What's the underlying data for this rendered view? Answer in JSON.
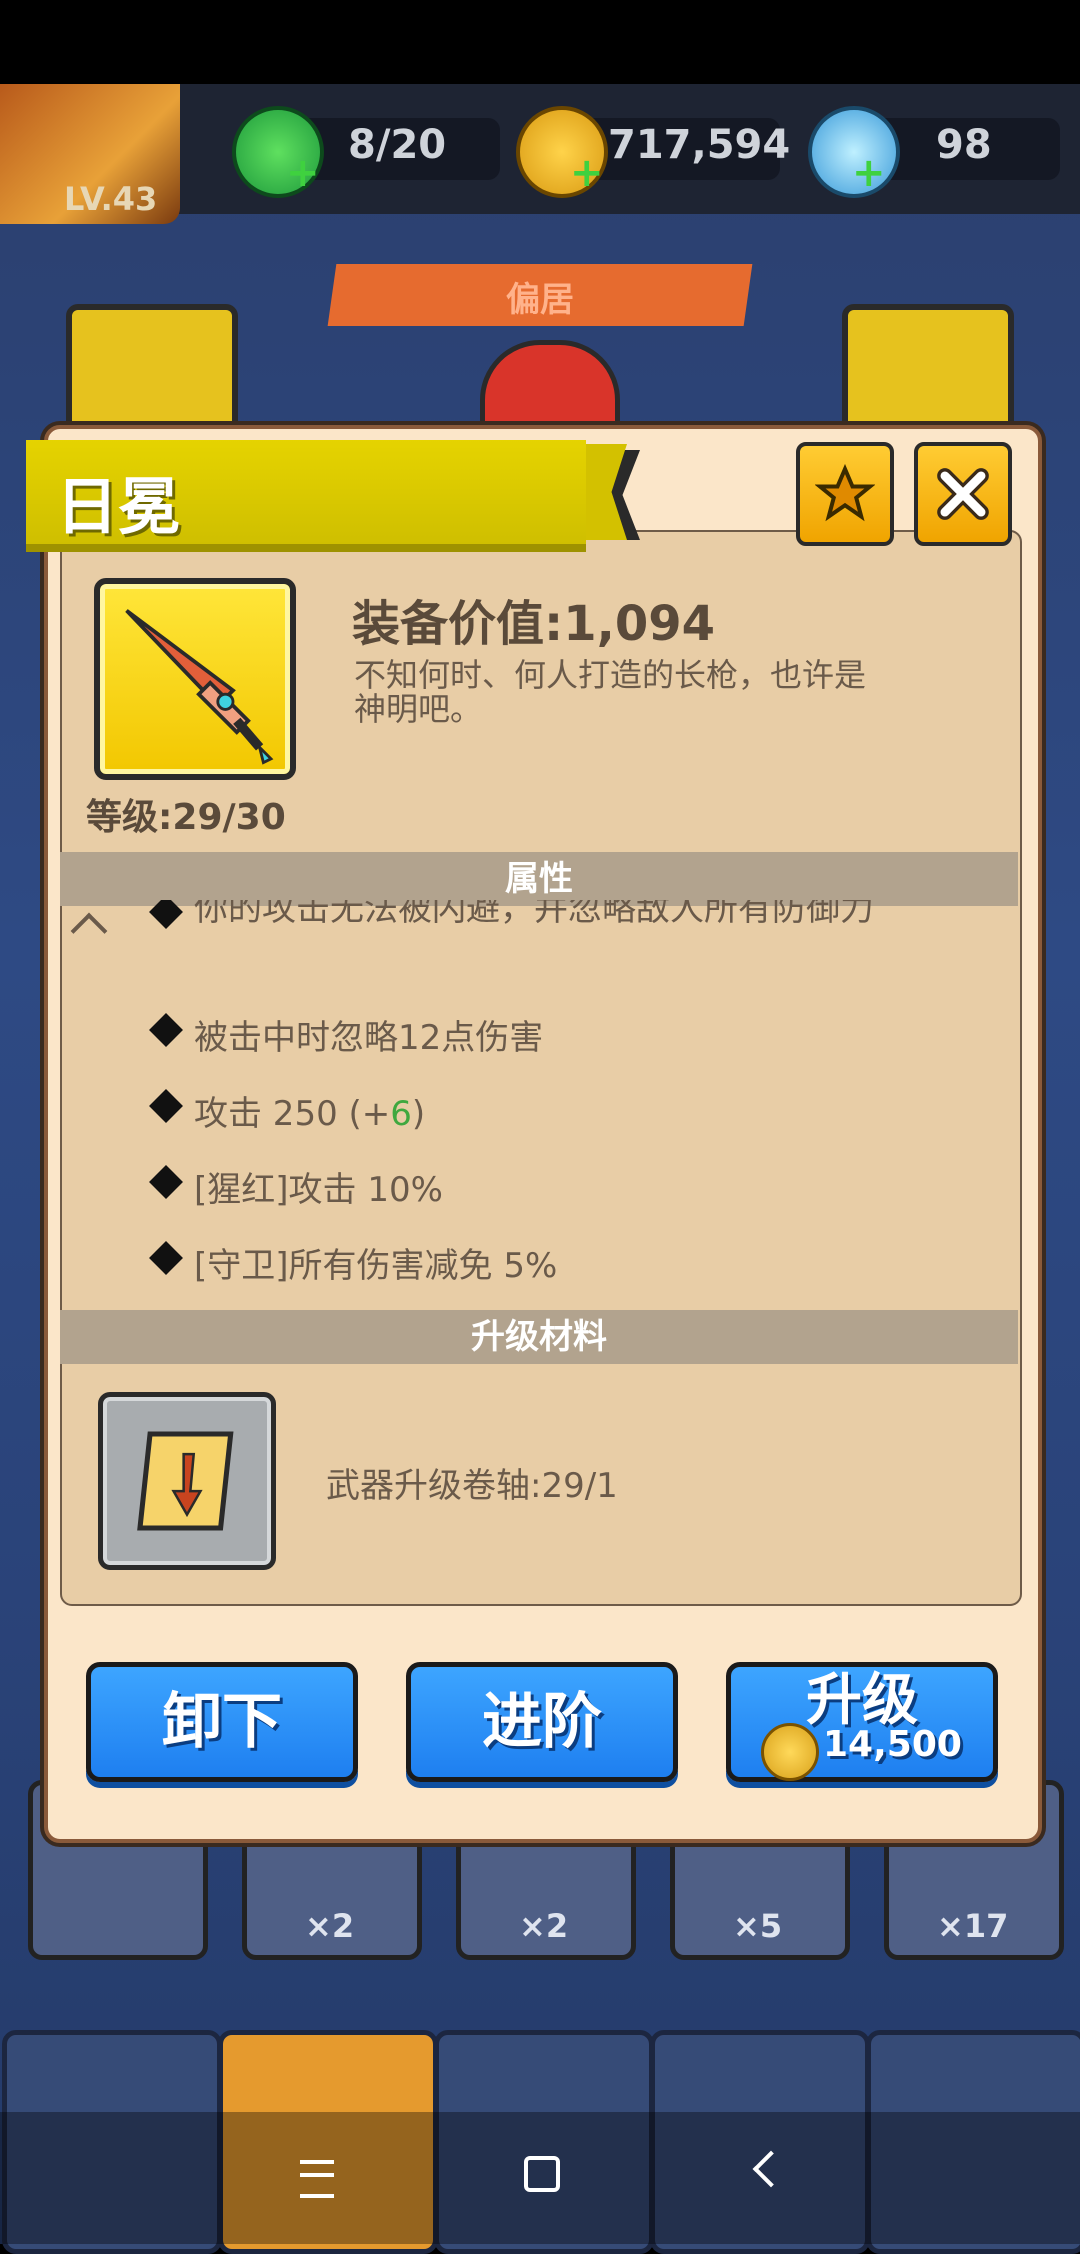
{
  "hud": {
    "player_level": "LV.43",
    "energy": "8/20",
    "gold": "717,594",
    "gems": "98",
    "section_title": "偏居"
  },
  "dialog": {
    "title": "日冕",
    "equip_value": "装备价值:1,094",
    "description": "不知何时、何人打造的长枪，也许是神明吧。",
    "level": "等级:29/30",
    "attributes_header": "属性",
    "attributes": [
      "你的攻击无法被闪避，并忽略敌人所有防御力",
      "被击中时忽略12点伤害",
      "攻击  250 (+6)",
      "[猩红]攻击 10%",
      "[守卫]所有伤害减免  5%"
    ],
    "attack_bonus": "+6",
    "materials_header": "升级材料",
    "material_label": "武器升级卷轴:29/1",
    "buttons": {
      "unequip": "卸下",
      "advance": "进阶",
      "upgrade": "升级",
      "upgrade_cost": "14,500"
    }
  },
  "background_scrolls": [
    "×2",
    "×2",
    "×5",
    "×17"
  ]
}
